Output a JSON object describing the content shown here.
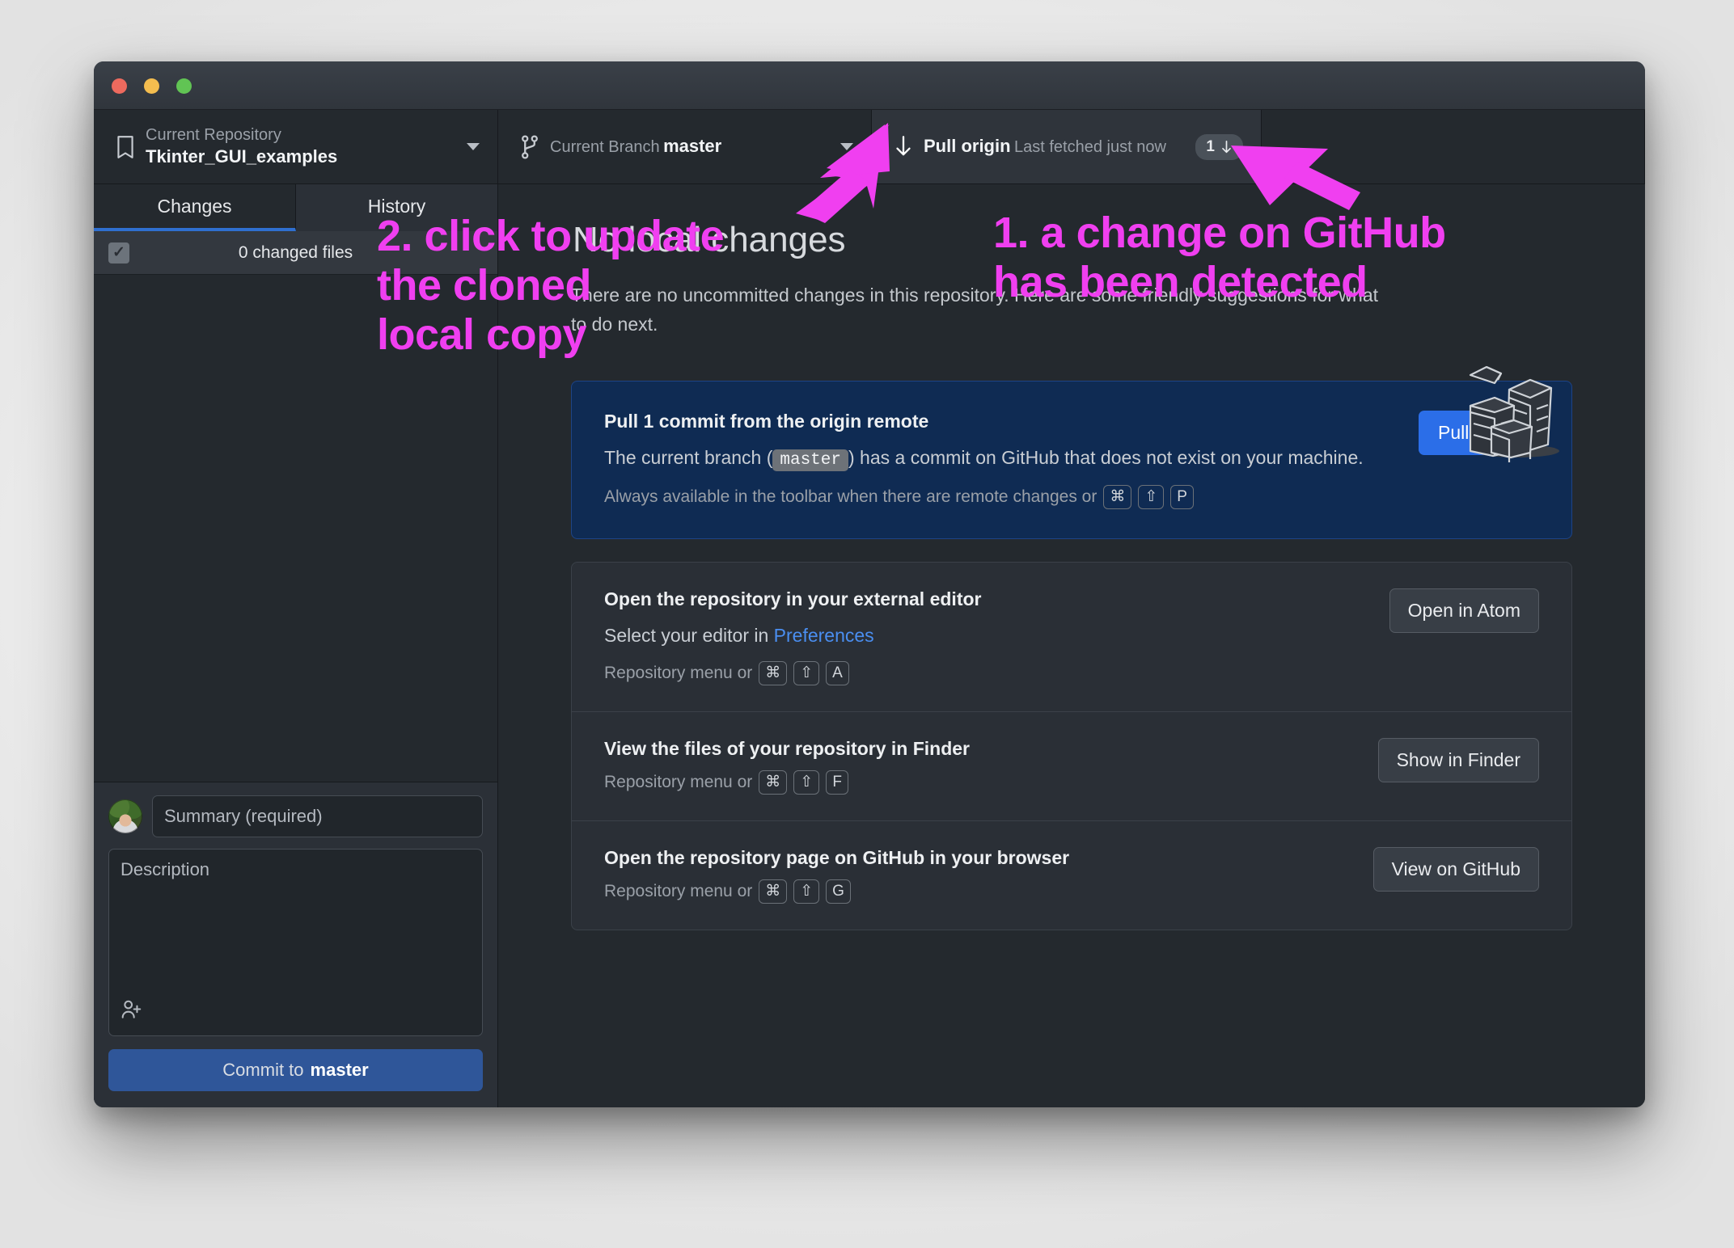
{
  "window": {
    "traffic_lights": [
      "close",
      "minimize",
      "zoom"
    ]
  },
  "toolbar": {
    "repository": {
      "label": "Current Repository",
      "value": "Tkinter_GUI_examples",
      "icon": "repository-icon",
      "caret": "chevron-down-icon"
    },
    "branch": {
      "label": "Current Branch",
      "value": "master",
      "icon": "branch-icon",
      "caret": "chevron-down-icon"
    },
    "pull": {
      "label": "Pull origin",
      "value": "Last fetched just now",
      "icon": "arrow-down-icon",
      "badge_count": "1",
      "badge_icon": "arrow-down-icon"
    }
  },
  "sidebar": {
    "tabs": [
      {
        "label": "Changes",
        "active": true
      },
      {
        "label": "History",
        "active": false
      }
    ],
    "changed_files_label": "0 changed files",
    "checkbox_glyph": "✓",
    "commit": {
      "summary_placeholder": "Summary (required)",
      "description_placeholder": "Description",
      "coauthor_icon": "add-coauthor-icon",
      "button_prefix": "Commit to ",
      "button_branch": "master"
    }
  },
  "main": {
    "blank_title": "No local changes",
    "blank_subtitle": "There are no uncommitted changes in this repository. Here are some friendly suggestions for what to do next.",
    "illustration": "stack-of-papers-illustration",
    "cards": [
      {
        "id": "pull-origin-card",
        "primary": true,
        "title": "Pull 1 commit from the origin remote",
        "desc_pre": "The current branch (",
        "desc_code": "master",
        "desc_post": ") has a commit on GitHub that does not exist on your machine.",
        "foot_text": "Always available in the toolbar when there are remote changes or",
        "keys": [
          "⌘",
          "⇧",
          "P"
        ],
        "button": "Pull origin"
      },
      {
        "id": "open-external-editor-card",
        "primary": false,
        "title": "Open the repository in your external editor",
        "desc_pre": "Select your editor in ",
        "desc_link": "Preferences",
        "desc_post": "",
        "foot_text": "Repository menu or",
        "keys": [
          "⌘",
          "⇧",
          "A"
        ],
        "button": "Open in Atom"
      },
      {
        "id": "show-in-finder-card",
        "primary": false,
        "title": "View the files of your repository in Finder",
        "desc_pre": "",
        "desc_link": "",
        "desc_post": "",
        "foot_text": "Repository menu or",
        "keys": [
          "⌘",
          "⇧",
          "F"
        ],
        "button": "Show in Finder"
      },
      {
        "id": "view-on-github-card",
        "primary": false,
        "title": "Open the repository page on GitHub in your browser",
        "desc_pre": "",
        "desc_link": "",
        "desc_post": "",
        "foot_text": "Repository menu or",
        "keys": [
          "⌘",
          "⇧",
          "G"
        ],
        "button": "View on GitHub"
      }
    ]
  },
  "annotations": {
    "left": "2. click to update\nthe cloned\nlocal copy",
    "right": "1. a change on GitHub\nhas been detected",
    "color": "#f03ff0"
  }
}
